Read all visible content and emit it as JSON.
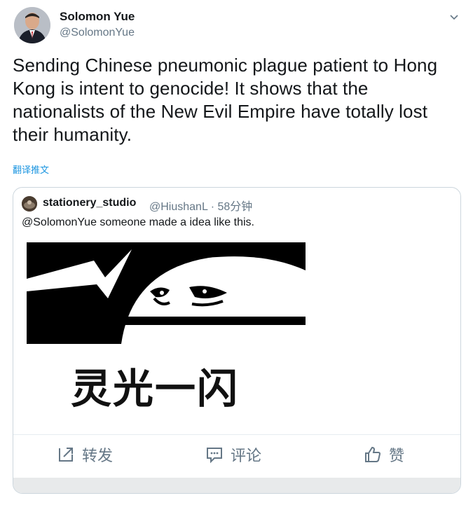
{
  "tweet": {
    "author_name": "Solomon Yue",
    "author_handle": "@SolomonYue",
    "text": "Sending Chinese pneumonic plague patient to Hong Kong is intent to genocide! It shows that the nationalists of the New Evil Empire have totally lost their humanity.",
    "translate_label": "翻译推文"
  },
  "quote": {
    "name": "stationery_studio",
    "handle_time": "@HiushanL · 58分钟",
    "text": "@SolomonYue someone made a idea like this.",
    "image_caption": "灵光一闪"
  },
  "actions": {
    "retweet_label": "转发",
    "comment_label": "评论",
    "like_label": "赞"
  },
  "colors": {
    "link": "#1b95e0",
    "secondary_text": "#657786",
    "border": "#ccd6dd"
  }
}
